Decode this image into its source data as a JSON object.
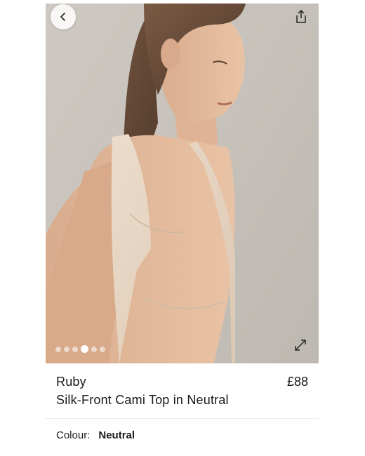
{
  "gallery": {
    "image_alt": "Model wearing silk-front cami top in neutral",
    "dot_count": 6,
    "active_dot": 3
  },
  "icons": {
    "back": "chevron-left-icon",
    "share": "share-icon",
    "expand": "expand-icon"
  },
  "product": {
    "brand": "Ruby",
    "name": "Silk-Front Cami Top in Neutral",
    "price": "£88"
  },
  "colour": {
    "label": "Colour:",
    "value": "Neutral"
  },
  "colors": {
    "garment": "#e7d7c4",
    "background_wall": "#c9c4bd"
  }
}
